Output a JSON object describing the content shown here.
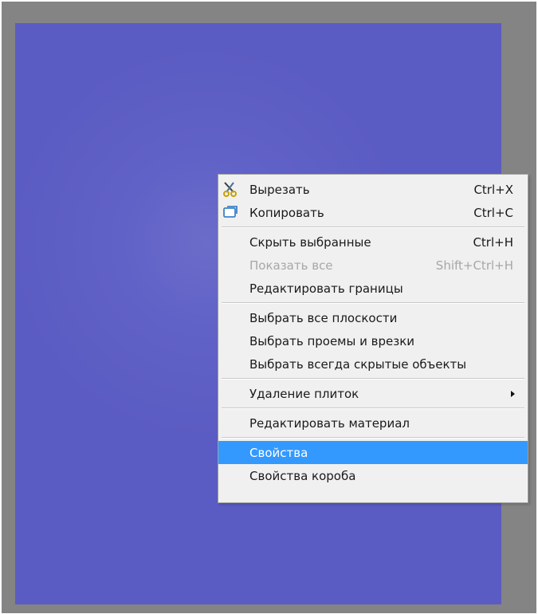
{
  "canvas": {
    "frame_color": "#848484",
    "viewport_color": "#5b5cc3"
  },
  "context_menu": {
    "items": [
      {
        "type": "item",
        "label": "Вырезать",
        "shortcut": "Ctrl+X",
        "icon": "scissors-icon",
        "enabled": true
      },
      {
        "type": "item",
        "label": "Копировать",
        "shortcut": "Ctrl+C",
        "icon": "copy-icon",
        "enabled": true
      },
      {
        "type": "separator"
      },
      {
        "type": "item",
        "label": "Скрыть выбранные",
        "shortcut": "Ctrl+H",
        "enabled": true
      },
      {
        "type": "item",
        "label": "Показать все",
        "shortcut": "Shift+Ctrl+H",
        "enabled": false
      },
      {
        "type": "item",
        "label": "Редактировать границы",
        "shortcut": "",
        "enabled": true
      },
      {
        "type": "separator"
      },
      {
        "type": "item",
        "label": "Выбрать все плоскости",
        "shortcut": "",
        "enabled": true
      },
      {
        "type": "item",
        "label": "Выбрать проемы и врезки",
        "shortcut": "",
        "enabled": true
      },
      {
        "type": "item",
        "label": "Выбрать всегда скрытые объекты",
        "shortcut": "",
        "enabled": true
      },
      {
        "type": "separator"
      },
      {
        "type": "item",
        "label": "Удаление плиток",
        "shortcut": "",
        "enabled": true,
        "submenu": true
      },
      {
        "type": "separator"
      },
      {
        "type": "item",
        "label": "Редактировать материал",
        "shortcut": "",
        "enabled": true
      },
      {
        "type": "separator"
      },
      {
        "type": "item",
        "label": "Свойства",
        "shortcut": "",
        "enabled": true,
        "highlighted": true
      },
      {
        "type": "item",
        "label": "Свойства короба",
        "shortcut": "",
        "enabled": true
      }
    ],
    "highlight_color": "#3399ff",
    "disabled_text_color": "#a7a7a7"
  }
}
